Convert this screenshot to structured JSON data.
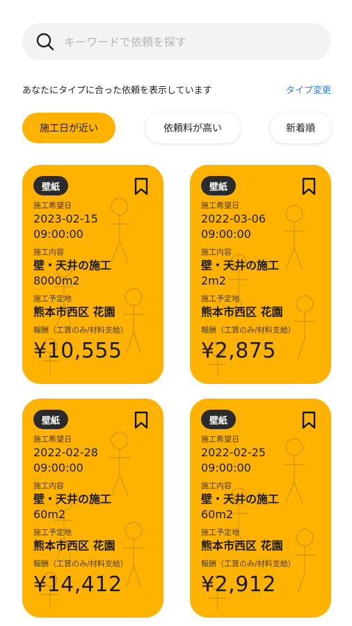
{
  "search": {
    "placeholder": "キーワードで依頼を探す"
  },
  "info": {
    "text": "あなたにタイプに合った依頼を表示しています",
    "change_label": "タイプ変更"
  },
  "filters": [
    {
      "label": "施工日が近い",
      "active": true
    },
    {
      "label": "依頼料が高い",
      "active": false
    },
    {
      "label": "新着順",
      "active": false
    }
  ],
  "labels": {
    "date": "施工希望日",
    "content": "施工内容",
    "place": "施工予定地",
    "reward": "報酬（工賃のみ/材料支給）"
  },
  "cards": [
    {
      "tag": "壁紙",
      "date": "2023-02-15",
      "time": "09:00:00",
      "work": "壁・天井の施工",
      "area": "8000m2",
      "place": "熊本市西区 花園",
      "price": "¥10,555"
    },
    {
      "tag": "壁紙",
      "date": "2022-03-06",
      "time": "09:00:00",
      "work": "壁・天井の施工",
      "area": "2m2",
      "place": "熊本市西区 花園",
      "price": "¥2,875"
    },
    {
      "tag": "壁紙",
      "date": "2022-02-28",
      "time": "09:00:00",
      "work": "壁・天井の施工",
      "area": "60m2",
      "place": "熊本市西区 花園",
      "price": "¥14,412"
    },
    {
      "tag": "壁紙",
      "date": "2022-02-25",
      "time": "09:00:00",
      "work": "壁・天井の施工",
      "area": "60m2",
      "place": "熊本市西区 花園",
      "price": "¥2,912"
    }
  ],
  "colors": {
    "accent": "#ffb300",
    "link": "#2f80ed",
    "tag_bg": "#2b2b2b"
  }
}
